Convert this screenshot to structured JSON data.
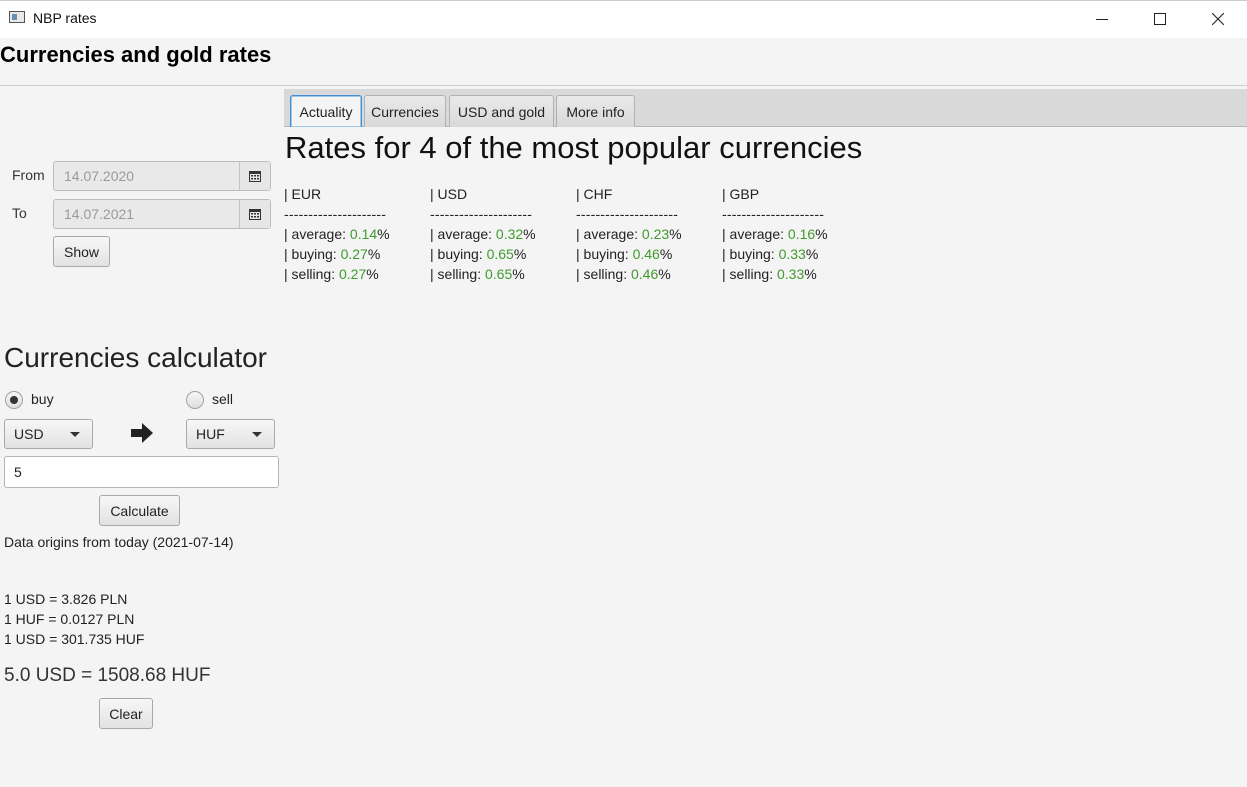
{
  "window": {
    "title": "NBP rates"
  },
  "header": {
    "title": "Currencies and gold rates"
  },
  "date_range": {
    "from_label": "From",
    "from_value": "14.07.2020",
    "to_label": "To",
    "to_value": "14.07.2021",
    "show_label": "Show"
  },
  "tabs": [
    {
      "label": "Actuality",
      "active": true
    },
    {
      "label": "Currencies",
      "active": false
    },
    {
      "label": "USD and gold",
      "active": false
    },
    {
      "label": "More info",
      "active": false
    }
  ],
  "rates": {
    "title": "Rates for 4 of the most popular currencies",
    "separator": "---------------------",
    "average_label": "average: ",
    "buying_label": "buying: ",
    "selling_label": "selling: ",
    "percent": "%",
    "bar": "| ",
    "columns": [
      {
        "code": "EUR",
        "average": "0.14",
        "buying": "0.27",
        "selling": "0.27"
      },
      {
        "code": "USD",
        "average": "0.32",
        "buying": "0.65",
        "selling": "0.65"
      },
      {
        "code": "CHF",
        "average": "0.23",
        "buying": "0.46",
        "selling": "0.46"
      },
      {
        "code": "GBP",
        "average": "0.16",
        "buying": "0.33",
        "selling": "0.33"
      }
    ]
  },
  "calculator": {
    "title": "Currencies calculator",
    "buy_label": "buy",
    "sell_label": "sell",
    "selected_mode": "buy",
    "from_currency": "USD",
    "to_currency": "HUF",
    "amount": "5",
    "calculate_label": "Calculate",
    "data_origin": "Data origins from today (2021-07-14)",
    "rate_lines": [
      "1 USD = 3.826 PLN",
      "1 HUF = 0.0127 PLN",
      "1 USD = 301.735 HUF"
    ],
    "result": "5.0 USD = 1508.68 HUF",
    "clear_label": "Clear"
  },
  "colors": {
    "positive": "#3f9a2d",
    "tab_focus": "#3f8fd2"
  }
}
